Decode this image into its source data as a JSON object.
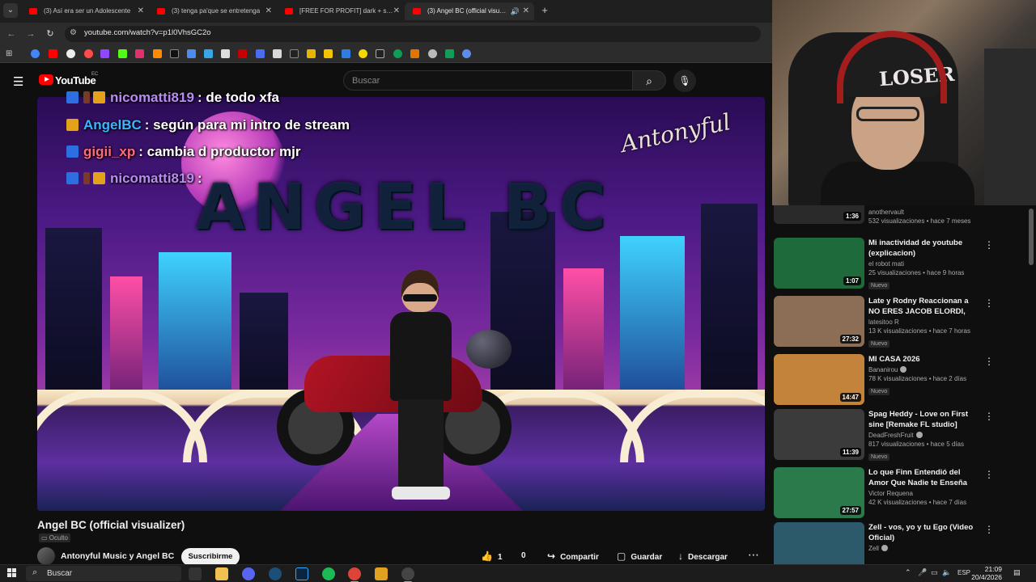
{
  "browser": {
    "tabs": [
      {
        "title": "(3) Así era ser un Adolescente",
        "active": false
      },
      {
        "title": "(3) tenga pa'que se entretenga",
        "active": false
      },
      {
        "title": "[FREE FOR PROFIT] dark + swag",
        "active": false
      },
      {
        "title": "(3) Angel BC (official visualiz",
        "active": true
      }
    ],
    "url": "youtube.com/watch?v=p1l0VhsGC2o"
  },
  "youtube": {
    "logo_text": "YouTube",
    "country": "EC",
    "search_placeholder": "Buscar"
  },
  "player": {
    "chat": [
      {
        "user": "nicomatti819",
        "message": ": de todo xfa",
        "user_color": "#b98cf0",
        "badges": [
          "prime",
          "sub",
          "crown"
        ]
      },
      {
        "user": "AngelBC",
        "message": ": según para mi intro de stream",
        "user_color": "#39b6ff",
        "badges": [
          "crown"
        ]
      },
      {
        "user": "gigii_xp",
        "message": ": cambia d productor mjr",
        "user_color": "#ff6a7a",
        "badges": [
          "prime"
        ]
      },
      {
        "user": "nicomatti819",
        "message": ":",
        "user_color": "#b98cf0",
        "badges": [
          "prime",
          "sub",
          "crown"
        ]
      }
    ],
    "art_title": "ANGEL BC",
    "signature": "Antonyful"
  },
  "video": {
    "title": "Angel BC (official visualizer)",
    "visibility": "Oculto",
    "channel": "Antonyful Music y Angel BC",
    "subscribe": "Suscribirme",
    "likes": "1",
    "dislikes": "0",
    "share": "Compartir",
    "save": "Guardar",
    "download": "Descargar"
  },
  "webcam": {
    "beanie_text": "LOSER"
  },
  "recommendations": [
    {
      "title": "",
      "channel": "anothervault",
      "meta": "532 visualizaciones • hace 7 meses",
      "duration": "1:36",
      "badge": "",
      "verified": false,
      "thumb_color": "#2a2a2a"
    },
    {
      "title": "Mi inactividad de youtube (explicacion)",
      "channel": "el robot mati",
      "meta": "25 visualizaciones • hace 9 horas",
      "duration": "1:07",
      "badge": "Nuevo",
      "verified": false,
      "thumb_color": "#1f6a3a"
    },
    {
      "title": "Late y Rodny Reaccionan a NO ERES JACOB ELORDI, MEJOR ...",
      "channel": "latesitoo R",
      "meta": "13 K visualizaciones • hace 7 horas",
      "duration": "27:32",
      "badge": "Nuevo",
      "verified": false,
      "thumb_color": "#8c6d55"
    },
    {
      "title": "MI CASA 2026",
      "channel": "Bananirou",
      "meta": "78 K visualizaciones • hace 2 días",
      "duration": "14:47",
      "badge": "Nuevo",
      "verified": true,
      "thumb_color": "#c3833a"
    },
    {
      "title": "Spag Heddy - Love on First sine [Remake FL studio] Dubstep - ...",
      "channel": "DeadFreshFruit",
      "meta": "817 visualizaciones • hace 5 días",
      "duration": "11:39",
      "badge": "Nuevo",
      "verified": true,
      "thumb_color": "#3b3b3b"
    },
    {
      "title": "Lo que Finn Entendió del Amor Que Nadie te Enseña",
      "channel": "Victor Requena",
      "meta": "42 K visualizaciones • hace 7 días",
      "duration": "27:57",
      "badge": "",
      "verified": false,
      "thumb_color": "#2a7a4c"
    },
    {
      "title": "Zell - vos, yo y tu Ego (Video Oficial)",
      "channel": "Zell",
      "meta": "",
      "duration": "",
      "badge": "",
      "verified": true,
      "thumb_color": "#2c5a6a"
    }
  ],
  "taskbar": {
    "search_text": "Buscar",
    "language": "ESP",
    "time": "21:09",
    "date": "20/4/2026"
  }
}
